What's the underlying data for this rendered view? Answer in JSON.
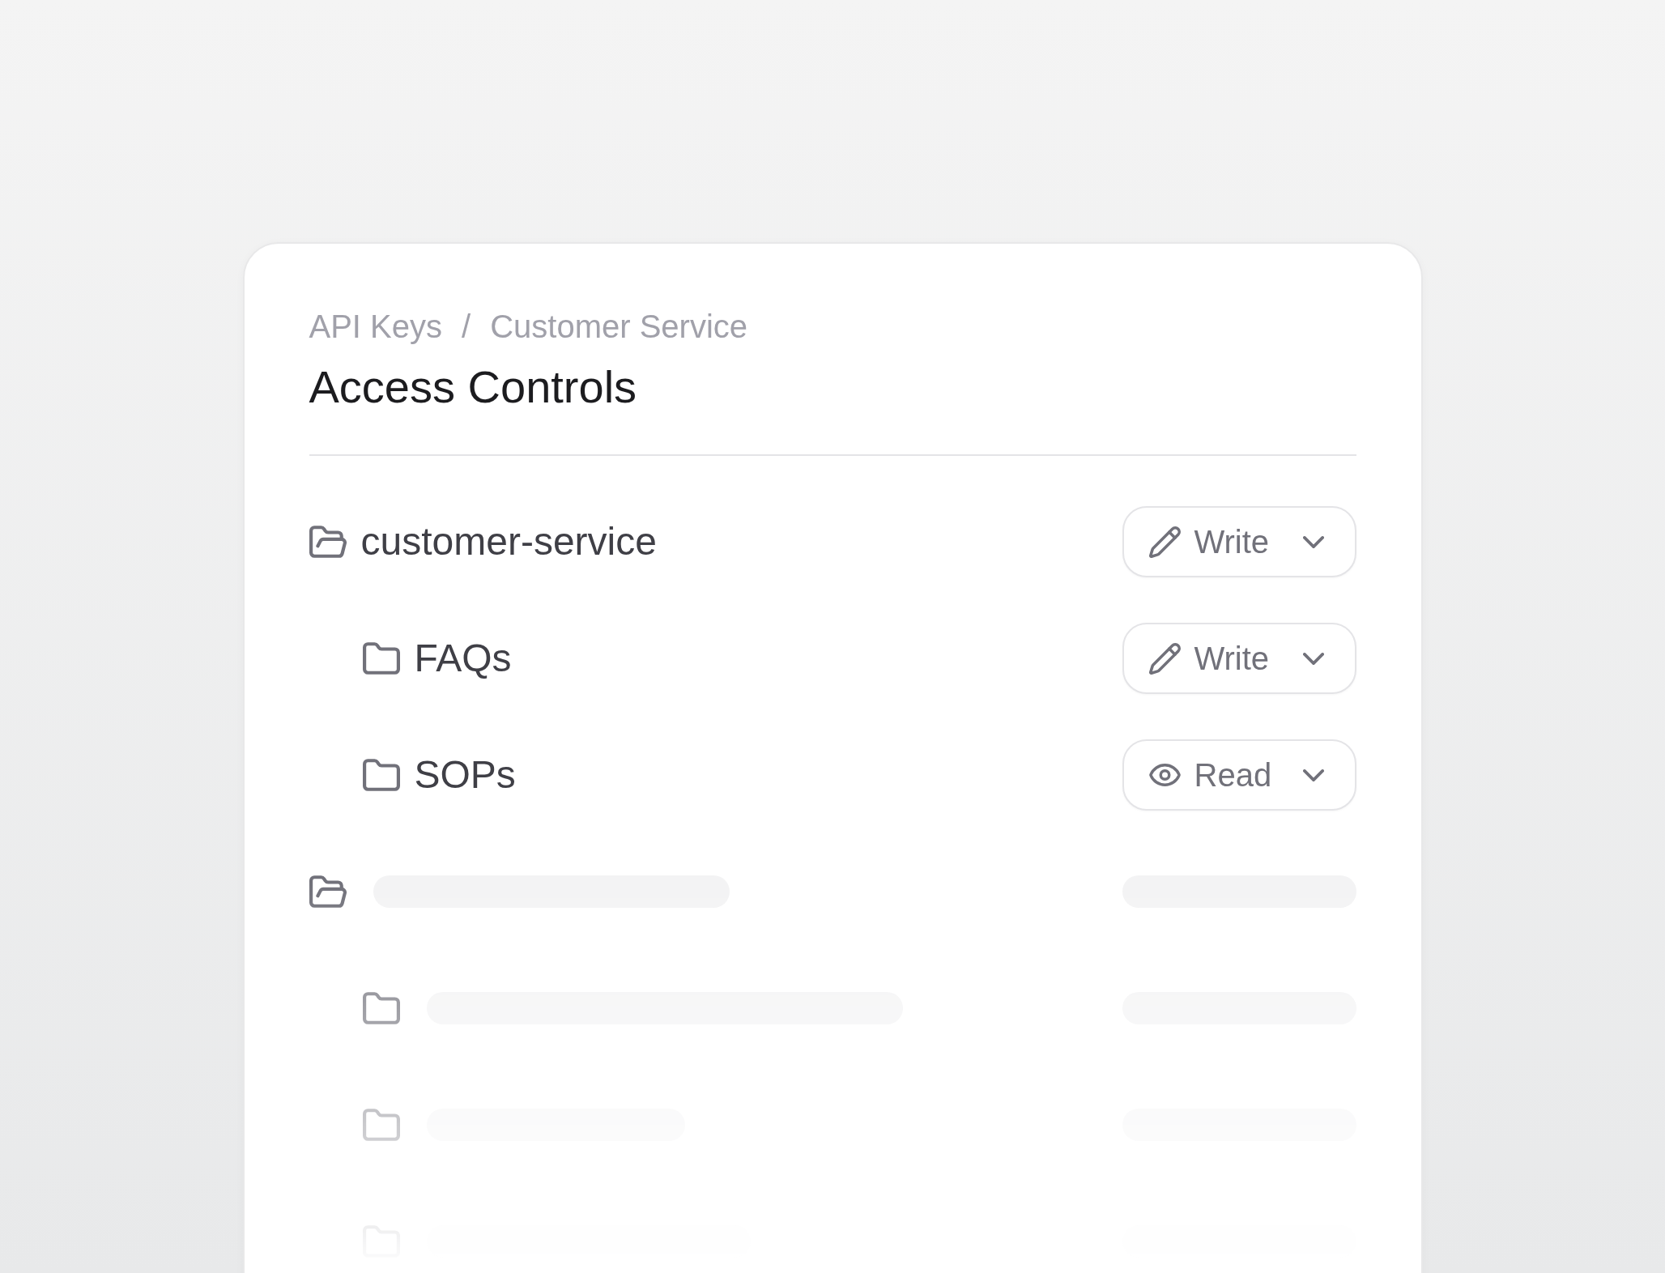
{
  "breadcrumb": {
    "items": [
      "API Keys",
      "Customer Service"
    ],
    "separator": "/"
  },
  "title": "Access Controls",
  "folders": [
    {
      "kind": "folder",
      "name": "customer-service",
      "expanded": true,
      "permission": {
        "kind": "write",
        "label": "Write"
      },
      "children": [
        {
          "kind": "folder",
          "name": "FAQs",
          "expanded": false,
          "permission": {
            "kind": "write",
            "label": "Write"
          }
        },
        {
          "kind": "folder",
          "name": "SOPs",
          "expanded": false,
          "permission": {
            "kind": "read",
            "label": "Read"
          }
        }
      ]
    },
    {
      "kind": "skeleton",
      "expanded": true,
      "children": [
        {
          "kind": "skeleton",
          "expanded": false
        },
        {
          "kind": "skeleton",
          "expanded": false
        },
        {
          "kind": "skeleton",
          "expanded": false
        }
      ]
    }
  ]
}
